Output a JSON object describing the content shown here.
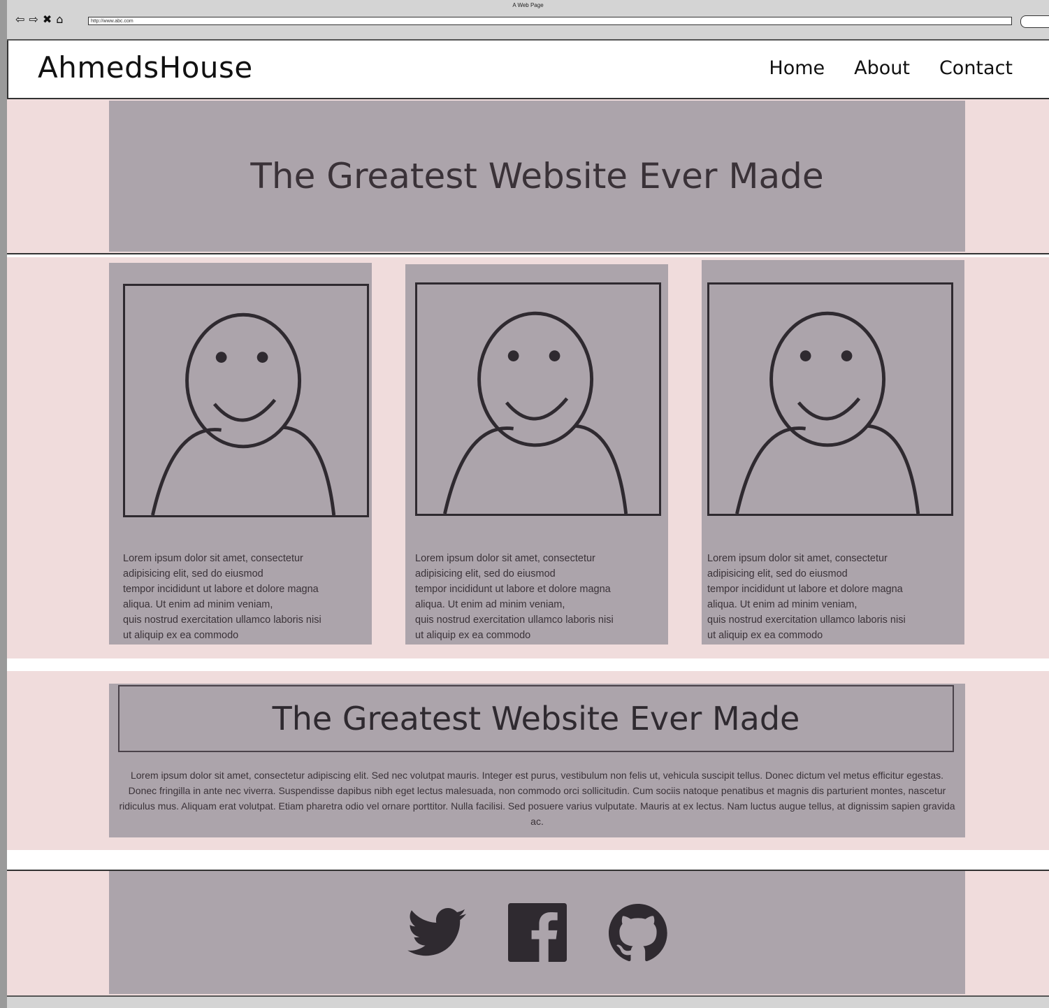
{
  "browser": {
    "window_title": "A Web Page",
    "url": "http://www.abc.com"
  },
  "header": {
    "logo": "AhmedsHouse",
    "nav": [
      "Home",
      "About",
      "Contact"
    ]
  },
  "hero": {
    "title": "The Greatest Website Ever Made"
  },
  "cards": [
    {
      "text": "Lorem ipsum dolor sit amet, consectetur\nadipisicing elit, sed do eiusmod\ntempor incididunt ut labore et dolore magna\naliqua. Ut enim ad minim veniam,\nquis nostrud exercitation ullamco laboris nisi\nut aliquip ex ea commodo"
    },
    {
      "text": "Lorem ipsum dolor sit amet, consectetur\nadipisicing elit, sed do eiusmod\ntempor incididunt ut labore et dolore magna\naliqua. Ut enim ad minim veniam,\nquis nostrud exercitation ullamco laboris nisi\nut aliquip ex ea commodo"
    },
    {
      "text": "Lorem ipsum dolor sit amet, consectetur\nadipisicing elit, sed do eiusmod\ntempor incididunt ut labore et dolore magna\naliqua. Ut enim ad minim veniam,\nquis nostrud exercitation ullamco laboris nisi\nut aliquip ex ea commodo"
    }
  ],
  "feature": {
    "title": "The Greatest Website Ever Made",
    "text": "Lorem ipsum dolor sit amet, consectetur adipiscing elit. Sed nec volutpat mauris. Integer est purus, vestibulum non felis ut, vehicula suscipit tellus. Donec dictum vel metus efficitur egestas. Donec fringilla in ante nec viverra. Suspendisse dapibus nibh eget lectus malesuada, non commodo orci sollicitudin. Cum sociis natoque penatibus et magnis dis parturient montes, nascetur ridiculus mus. Aliquam erat volutpat. Etiam pharetra odio vel ornare porttitor. Nulla facilisi. Sed posuere varius vulputate. Mauris at ex lectus. Nam luctus augue tellus, at dignissim sapien gravida ac."
  },
  "footer": {
    "icons": [
      "twitter-icon",
      "facebook-icon",
      "github-icon"
    ]
  },
  "colors": {
    "page_bg": "#f0dcdc",
    "panel": "#aca4ab",
    "ink": "#2f2a30"
  }
}
